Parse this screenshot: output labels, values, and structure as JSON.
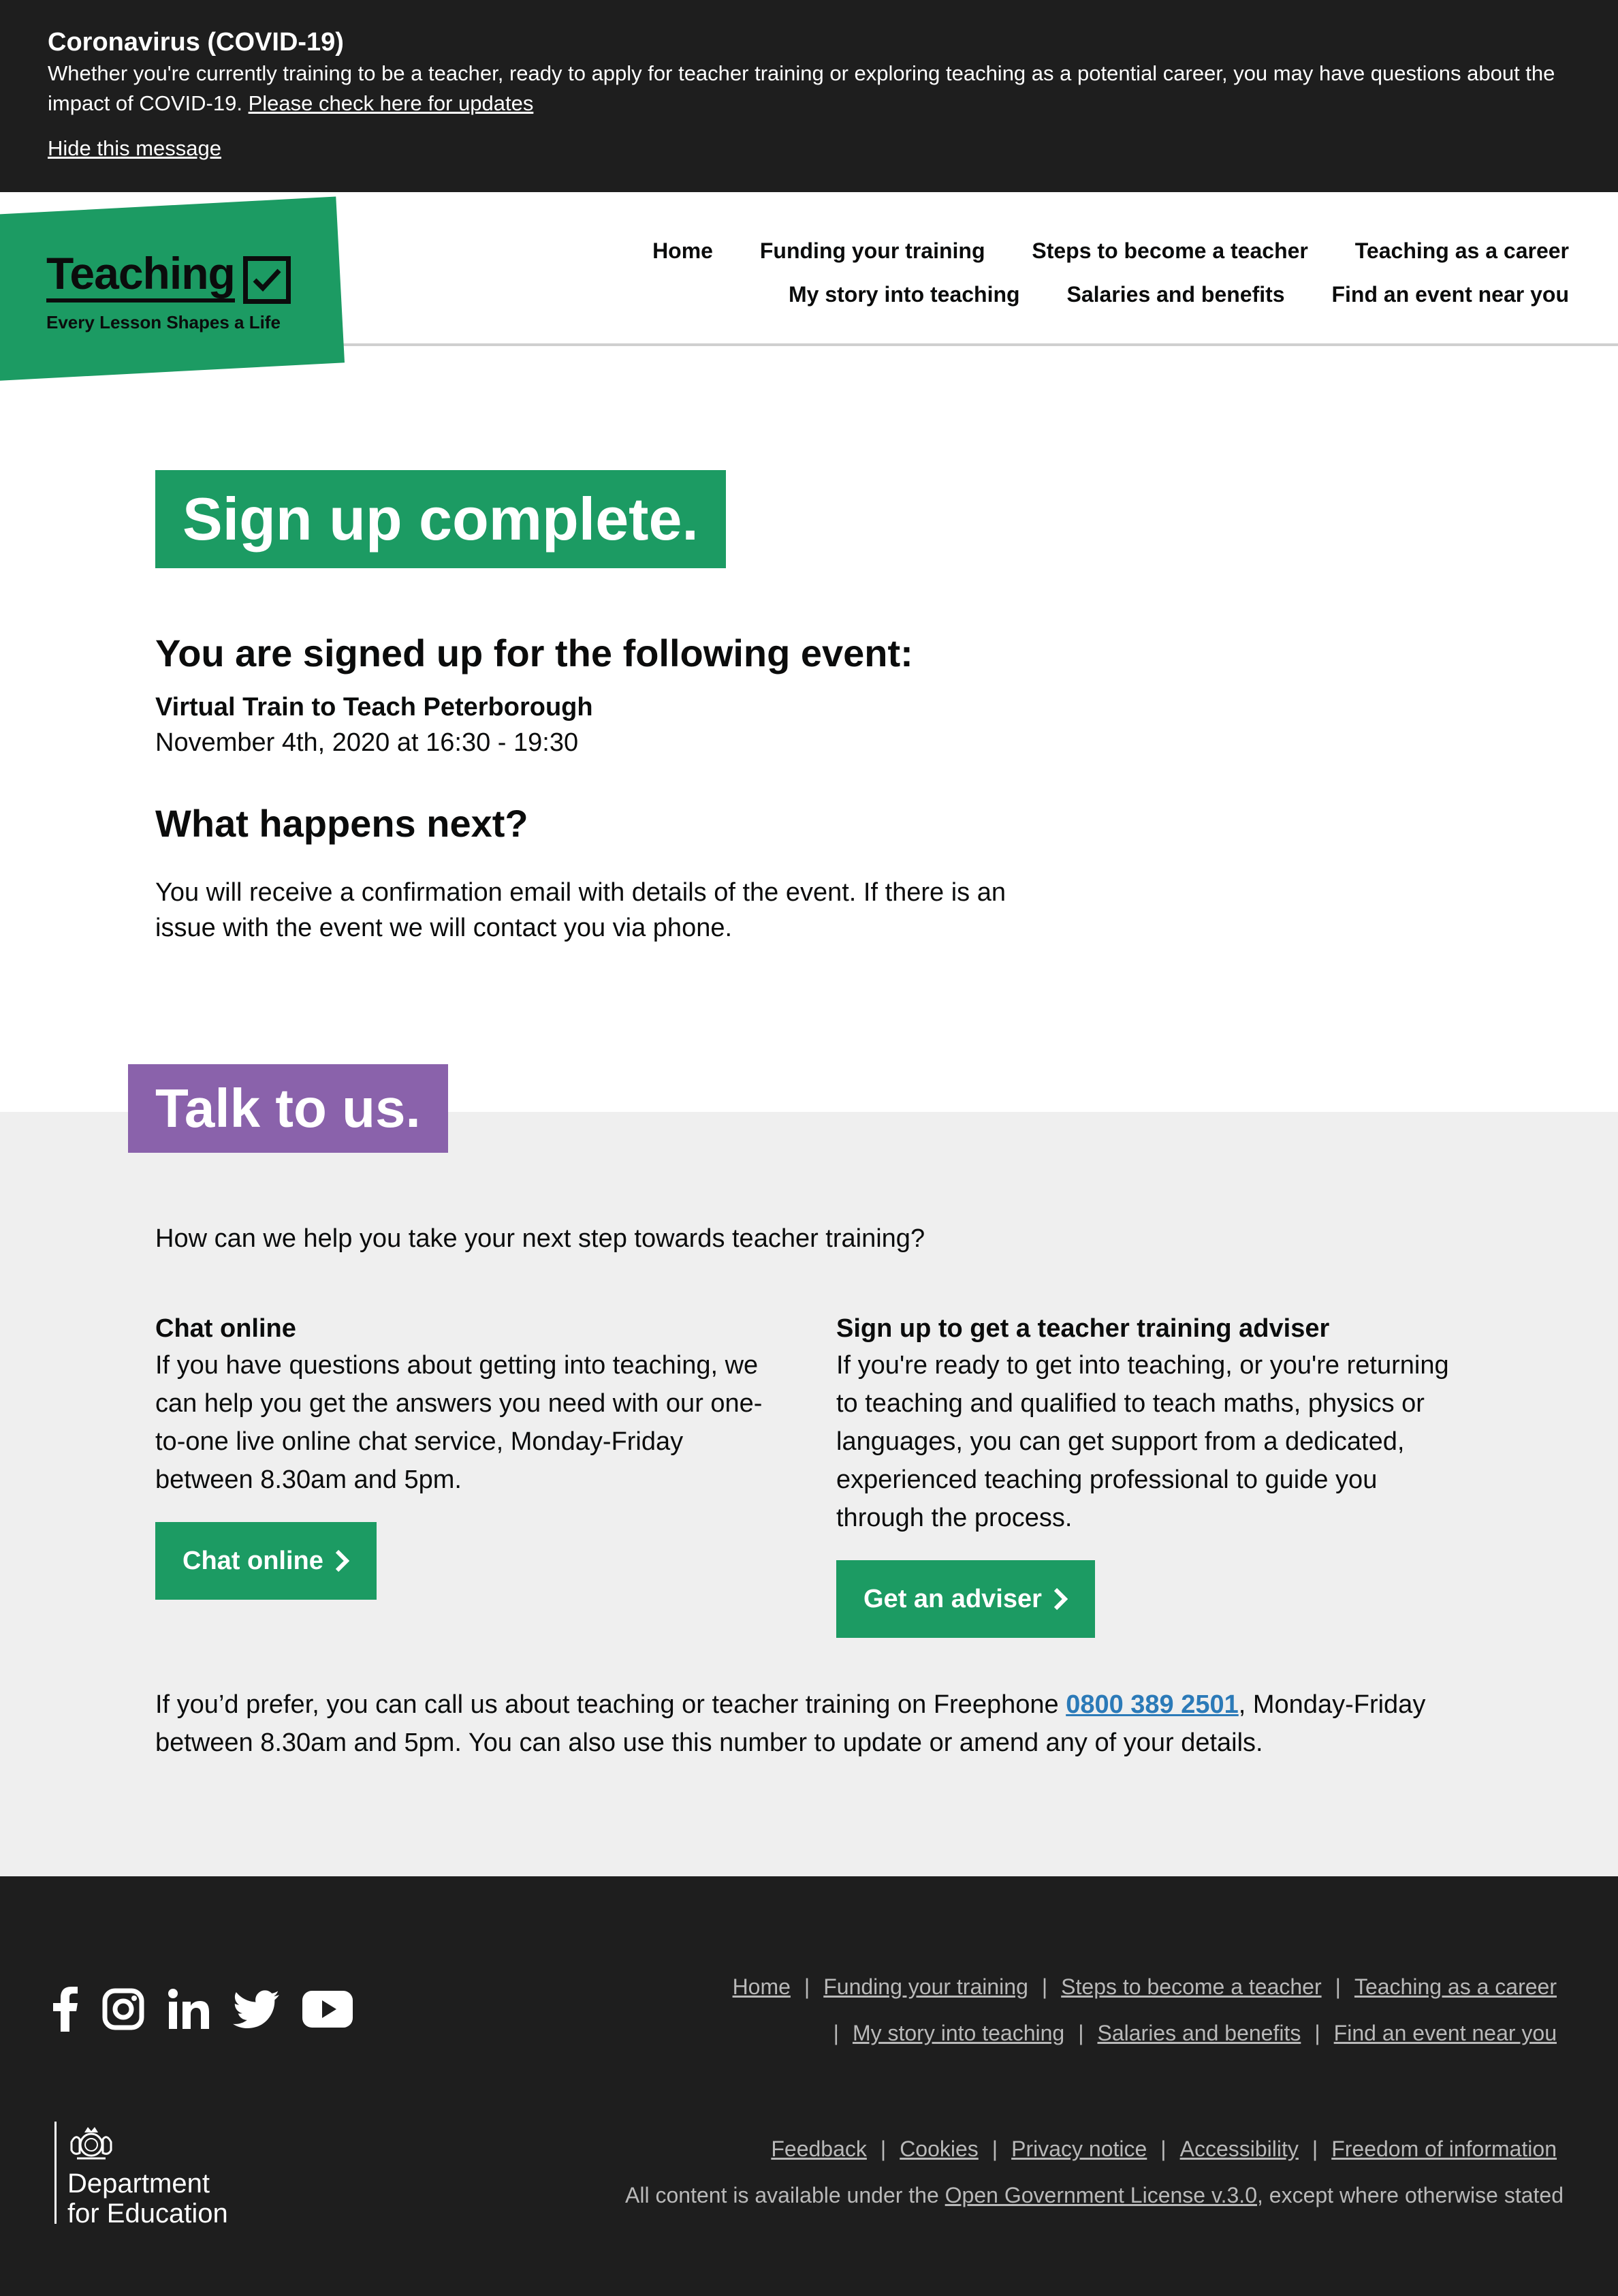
{
  "covid": {
    "title": "Coronavirus (COVID-19)",
    "text": "Whether you're currently training to be a teacher, ready to apply for teacher training or exploring teaching as a potential career, you may have questions about the impact of COVID-19. ",
    "link": "Please check here for updates",
    "hide": "Hide this message"
  },
  "logo": {
    "word": "Teaching",
    "tagline": "Every Lesson Shapes a Life",
    "icon": "checkbox-tick-icon"
  },
  "nav": {
    "row1": [
      "Home",
      "Funding your training",
      "Steps to become a teacher",
      "Teaching as a career"
    ],
    "row2": [
      "My story into teaching",
      "Salaries and benefits",
      "Find an event near you"
    ]
  },
  "main": {
    "hero_title": "Sign up complete.",
    "signed_up_heading": "You are signed up for the following event:",
    "event_name": "Virtual Train to Teach Peterborough",
    "event_date": "November 4th, 2020 at 16:30 - 19:30",
    "next_heading": "What happens next?",
    "next_text": "You will receive a confirmation email with details of the event. If there is an issue with the event we will contact you via phone."
  },
  "talk": {
    "badge": "Talk to us.",
    "question": "How can we help you take your next step towards teacher training?",
    "chat_title": "Chat online",
    "chat_text": "If you have questions about getting into teaching, we can help you get the answers you need with our one-to-one live online chat service, Monday-Friday between 8.30am and 5pm.",
    "chat_button": "Chat online",
    "adviser_title": "Sign up to get a teacher training adviser",
    "adviser_text": "If you're ready to get into teaching, or you're returning to teaching and qualified to teach maths, physics or languages, you can get support from a dedicated, experienced teaching professional to guide you through the process.",
    "adviser_button": "Get an adviser",
    "phone_pre": "If you’d prefer, you can call us about teaching or teacher training on Freephone ",
    "phone_number": "0800 389 2501",
    "phone_post": ", Monday-Friday between 8.30am and 5pm. You can also use this number to update or amend any of your details."
  },
  "footer": {
    "social_icons": [
      "facebook-icon",
      "instagram-icon",
      "linkedin-icon",
      "twitter-icon",
      "youtube-icon"
    ],
    "links_row1": [
      "Home",
      "Funding your training",
      "Steps to become a teacher",
      "Teaching as a career"
    ],
    "links_row2": [
      "My story into teaching",
      "Salaries and benefits",
      "Find an event near you"
    ],
    "links_row3": [
      "Feedback",
      "Cookies",
      "Privacy notice",
      "Accessibility",
      "Freedom of information"
    ],
    "license_pre": "All content is available under the ",
    "license_link": "Open Government License v.3.0",
    "license_post": ", except where otherwise stated",
    "dfe_line1": "Department",
    "dfe_line2": "for Education"
  },
  "colors": {
    "brand_green": "#1c9b63",
    "talk_purple": "#8a62ab",
    "dark": "#1e1e1e",
    "link_blue": "#2b7ab8"
  }
}
